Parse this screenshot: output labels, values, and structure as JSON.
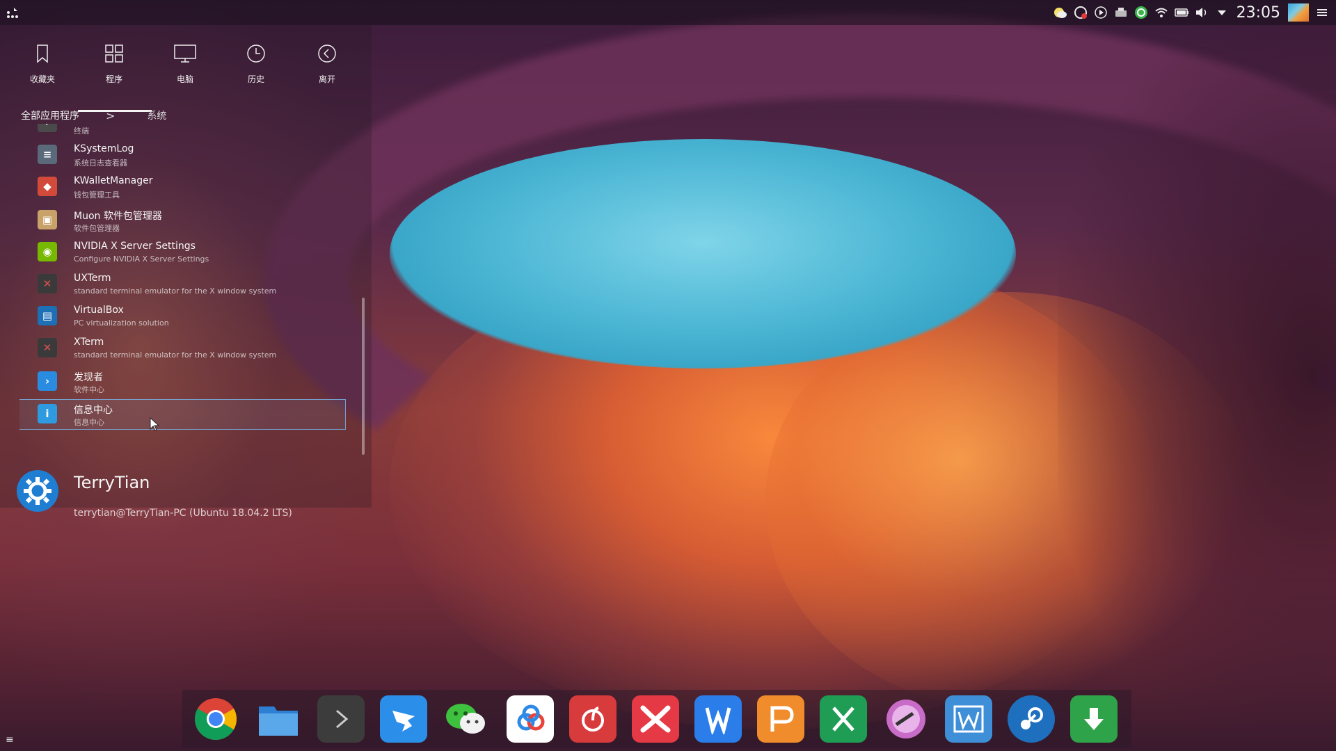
{
  "top_panel": {
    "launcher_icon": "kde-kickoff-icon",
    "clock": "23:05",
    "tray_icons": [
      "weather-icon",
      "update-icon",
      "media-player-icon",
      "printer-icon",
      "360-security-icon",
      "wifi-icon",
      "battery-icon",
      "volume-icon",
      "expand-arrow-icon"
    ],
    "menu_icon": "hamburger-menu-icon"
  },
  "launcher": {
    "tabs": [
      {
        "label": "收藏夹",
        "icon": "bookmark-icon"
      },
      {
        "label": "程序",
        "icon": "grid-icon"
      },
      {
        "label": "电脑",
        "icon": "monitor-icon"
      },
      {
        "label": "历史",
        "icon": "clock-icon"
      },
      {
        "label": "离开",
        "icon": "back-circle-icon"
      }
    ],
    "breadcrumb": {
      "root": "全部应用程序",
      "separator": ">",
      "current": "系统"
    },
    "apps": [
      {
        "name": "",
        "desc": "终端",
        "icon": "terminal-icon",
        "color": "#4a4a4a"
      },
      {
        "name": "KSystemLog",
        "desc": "系统日志查看器",
        "icon": "log-icon",
        "color": "#5a6a7a"
      },
      {
        "name": "KWalletManager",
        "desc": "钱包管理工具",
        "icon": "wallet-icon",
        "color": "#d14a3a"
      },
      {
        "name": "Muon 软件包管理器",
        "desc": "软件包管理器",
        "icon": "package-icon",
        "color": "#c9a26a"
      },
      {
        "name": "NVIDIA X Server Settings",
        "desc": "Configure NVIDIA X Server Settings",
        "icon": "nvidia-icon",
        "color": "#76b900"
      },
      {
        "name": "UXTerm",
        "desc": "standard terminal emulator for the X window system",
        "icon": "xterm-icon",
        "color": "#3a3a3a"
      },
      {
        "name": "VirtualBox",
        "desc": "PC virtualization solution",
        "icon": "virtualbox-icon",
        "color": "#1d6fb6"
      },
      {
        "name": "XTerm",
        "desc": "standard terminal emulator for the X window system",
        "icon": "xterm-icon",
        "color": "#3a3a3a"
      },
      {
        "name": "发现者",
        "desc": "软件中心",
        "icon": "discover-icon",
        "color": "#2a8ce0"
      },
      {
        "name": "信息中心",
        "desc": "信息中心",
        "icon": "info-center-icon",
        "color": "#2e9be0"
      }
    ],
    "selected_index": 9,
    "user": {
      "name": "TerryTian",
      "host": "terrytian@TerryTian-PC (Ubuntu 18.04.2 LTS)",
      "avatar_icon": "kde-gear-icon"
    }
  },
  "dock": {
    "items": [
      {
        "name": "chrome",
        "icon": "chrome-icon",
        "bg": "transparent"
      },
      {
        "name": "files",
        "icon": "folder-icon",
        "bg": "#2d7fd4"
      },
      {
        "name": "terminal",
        "icon": "terminal-prompt-icon",
        "bg": "#3c3c3c"
      },
      {
        "name": "dingtalk",
        "icon": "dingtalk-icon",
        "bg": "#2b8fea"
      },
      {
        "name": "wechat",
        "icon": "wechat-icon",
        "bg": "transparent"
      },
      {
        "name": "baidu-netdisk",
        "icon": "cloud-icon",
        "bg": "#ffffff"
      },
      {
        "name": "netease-music",
        "icon": "music-icon",
        "bg": "#d83b3b"
      },
      {
        "name": "xmind",
        "icon": "xmind-icon",
        "bg": "#e63946"
      },
      {
        "name": "wps-writer",
        "icon": "wps-writer-icon",
        "bg": "#2b7de9"
      },
      {
        "name": "wps-presentation",
        "icon": "wps-presentation-icon",
        "bg": "#f08c2c"
      },
      {
        "name": "wps-spreadsheet",
        "icon": "wps-spreadsheet-icon",
        "bg": "#1f9d55"
      },
      {
        "name": "flameshot",
        "icon": "flameshot-icon",
        "bg": "transparent"
      },
      {
        "name": "wps-pdf",
        "icon": "wps-pdf-icon",
        "bg": "#3f8fd8"
      },
      {
        "name": "steam",
        "icon": "steam-icon",
        "bg": "#1e6fbd"
      },
      {
        "name": "downloader",
        "icon": "download-icon",
        "bg": "#2fa34a"
      }
    ]
  }
}
